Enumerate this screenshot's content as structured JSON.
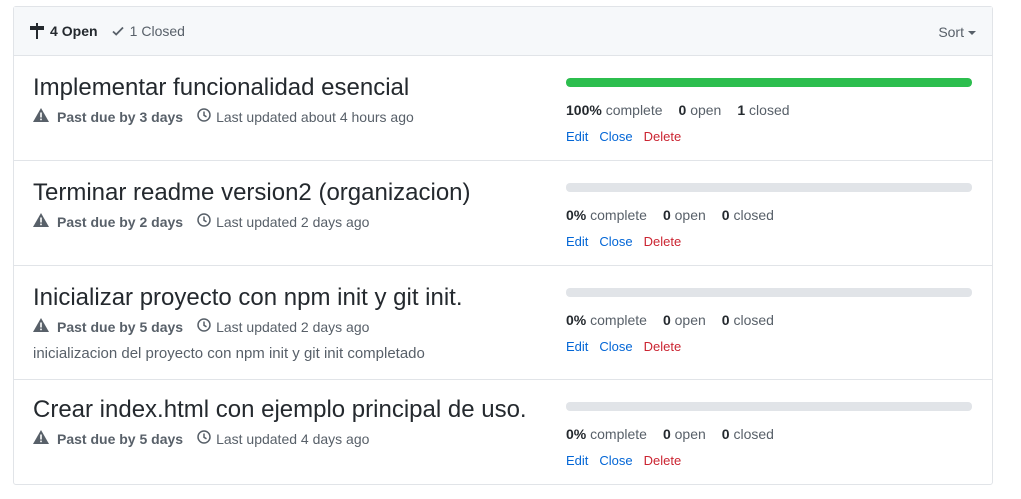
{
  "header": {
    "open_count": "4",
    "open_label": "Open",
    "closed_count": "1",
    "closed_label": "Closed",
    "sort_label": "Sort"
  },
  "milestones": [
    {
      "title": "Implementar funcionalidad esencial",
      "due": "Past due by 3 days",
      "updated": "Last updated about 4 hours ago",
      "description": "",
      "progress": 100,
      "complete_pct": "100%",
      "complete_label": "complete",
      "open_count": "0",
      "open_label": "open",
      "closed_count": "1",
      "closed_label": "closed"
    },
    {
      "title": "Terminar readme version2 (organizacion)",
      "due": "Past due by 2 days",
      "updated": "Last updated 2 days ago",
      "description": "",
      "progress": 0,
      "complete_pct": "0%",
      "complete_label": "complete",
      "open_count": "0",
      "open_label": "open",
      "closed_count": "0",
      "closed_label": "closed"
    },
    {
      "title": "Inicializar proyecto con npm init y git init.",
      "due": "Past due by 5 days",
      "updated": "Last updated 2 days ago",
      "description": "inicializacion del proyecto con npm init y git init completado",
      "progress": 0,
      "complete_pct": "0%",
      "complete_label": "complete",
      "open_count": "0",
      "open_label": "open",
      "closed_count": "0",
      "closed_label": "closed"
    },
    {
      "title": "Crear index.html con ejemplo principal de uso.",
      "due": "Past due by 5 days",
      "updated": "Last updated 4 days ago",
      "description": "",
      "progress": 0,
      "complete_pct": "0%",
      "complete_label": "complete",
      "open_count": "0",
      "open_label": "open",
      "closed_count": "0",
      "closed_label": "closed"
    }
  ],
  "actions": {
    "edit": "Edit",
    "close": "Close",
    "delete": "Delete"
  },
  "colors": {
    "progress": "#2cbe4e",
    "link": "#0366d6",
    "danger": "#cb2431"
  }
}
